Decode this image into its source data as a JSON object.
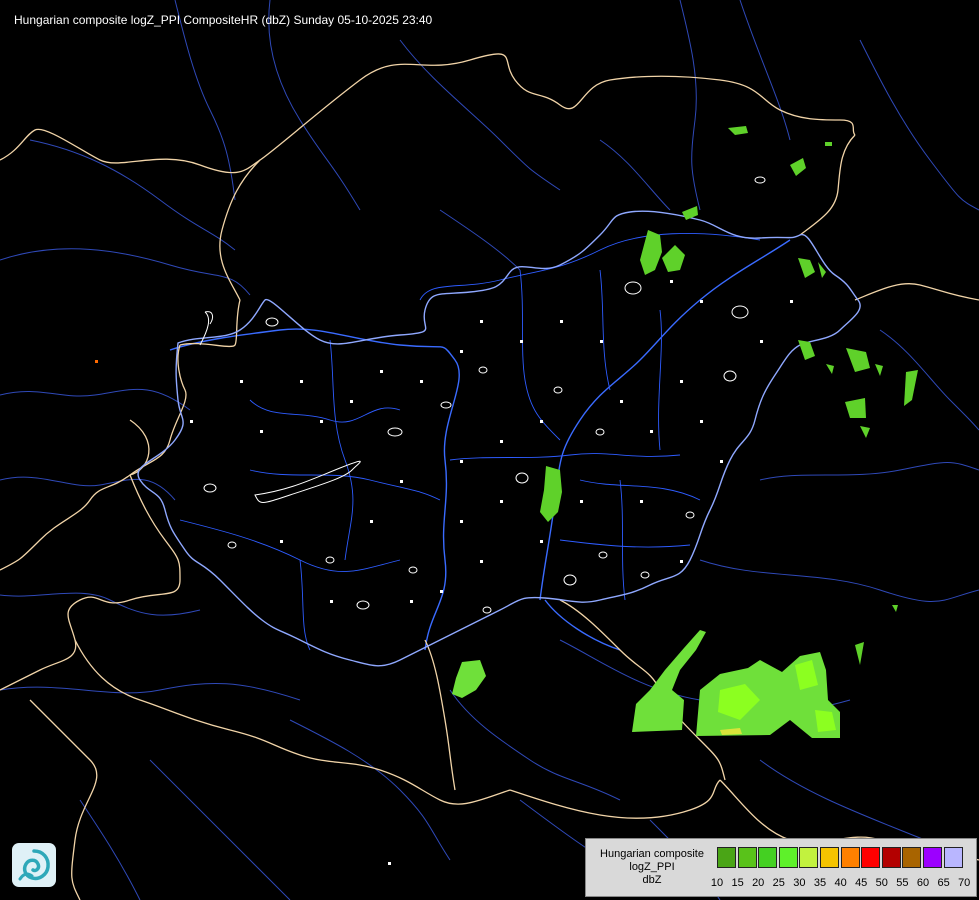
{
  "title": "Hungarian composite logZ_PPI CompositeHR (dbZ) Sunday 05-10-2025 23:40",
  "colors": {
    "background": "#000000",
    "country_border": "#f1d4a8",
    "river": "#2a55ee",
    "county_border": "#3366ff",
    "settlement": "#ffffff",
    "echo_light": "#5fd12a",
    "echo_bright": "#8cff20"
  },
  "logo": {
    "icon": "met-service-swirl-icon"
  },
  "legend": {
    "label_lines": [
      "Hungarian composite",
      "logZ_PPI",
      "dbZ"
    ],
    "ticks": [
      "10",
      "15",
      "20",
      "25",
      "30",
      "35",
      "40",
      "45",
      "50",
      "55",
      "60",
      "65",
      "70"
    ],
    "swatch_colors": [
      "#4aa516",
      "#59c21a",
      "#44d022",
      "#5ef12a",
      "#c2f23e",
      "#f5c400",
      "#ff8000",
      "#ff0000",
      "#b30000",
      "#a86400",
      "#9c00ff",
      "#b9b6ff"
    ]
  }
}
